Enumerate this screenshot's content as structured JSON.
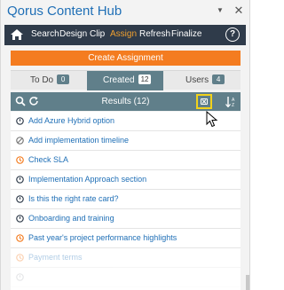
{
  "app": {
    "title": "Qorus Content Hub"
  },
  "nav": {
    "items": [
      {
        "label": "Search"
      },
      {
        "label": "Design"
      },
      {
        "label": "Clip"
      },
      {
        "label": "Assign"
      },
      {
        "label": "Refresh"
      },
      {
        "label": "Finalize"
      }
    ],
    "active": "Assign",
    "help_label": "?"
  },
  "create_button": {
    "label": "Create Assignment"
  },
  "tabs": [
    {
      "label": "To Do",
      "count": "0"
    },
    {
      "label": "Created",
      "count": "12"
    },
    {
      "label": "Users",
      "count": "4"
    }
  ],
  "active_tab": "Created",
  "results": {
    "title": "Results (12)"
  },
  "items": [
    {
      "label": "Add Azure Hybrid option",
      "status": "open"
    },
    {
      "label": "Add implementation timeline",
      "status": "declined"
    },
    {
      "label": "Check SLA",
      "status": "pending"
    },
    {
      "label": "Implementation Approach section",
      "status": "open"
    },
    {
      "label": "Is this the right rate card?",
      "status": "open"
    },
    {
      "label": "Onboarding and training",
      "status": "open"
    },
    {
      "label": "Past year's project performance highlights",
      "status": "pending"
    },
    {
      "label": "Payment terms",
      "status": "pending"
    },
    {
      "label": "",
      "status": "open"
    }
  ],
  "colors": {
    "accent": "#f47c20",
    "nav_bg": "#2f3b4a",
    "nav_active": "#f0a030",
    "panel": "#607f8a",
    "link": "#1f6fb6",
    "highlight": "#f2d21b"
  }
}
